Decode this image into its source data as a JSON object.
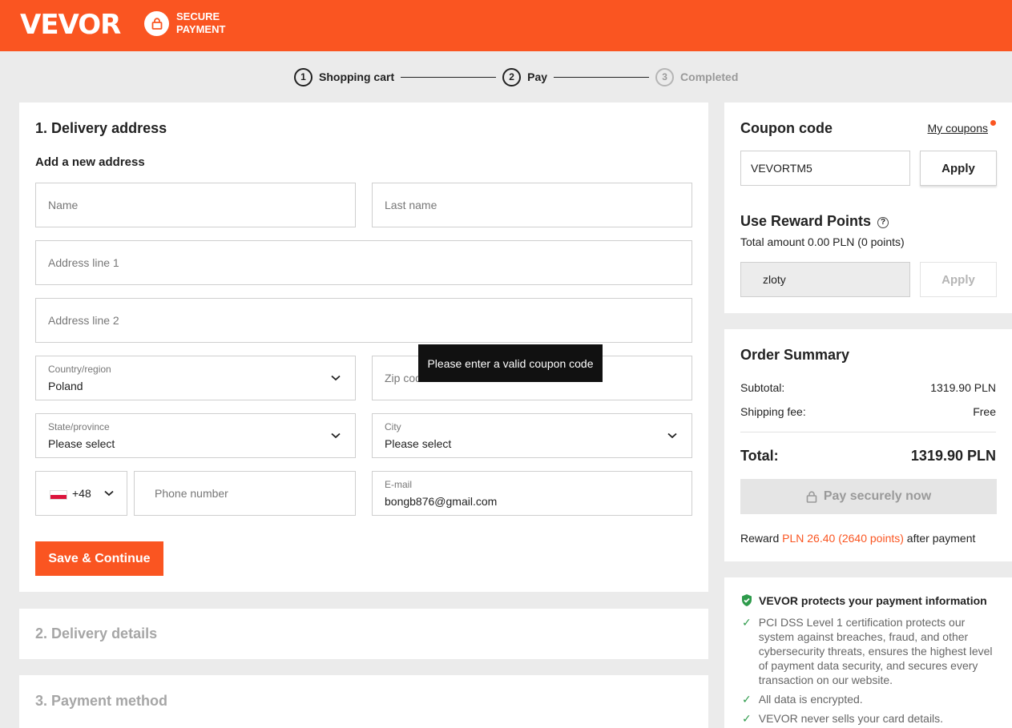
{
  "header": {
    "logo_text": "VEVOR",
    "secure_line1": "SECURE",
    "secure_line2": "PAYMENT",
    "accent_color": "#fa5521"
  },
  "steps": [
    {
      "num": "1",
      "label": "Shopping cart",
      "state": "done"
    },
    {
      "num": "2",
      "label": "Pay",
      "state": "current"
    },
    {
      "num": "3",
      "label": "Completed",
      "state": "upcoming"
    }
  ],
  "delivery": {
    "title": "1. Delivery address",
    "subtitle": "Add a new address",
    "name_placeholder": "Name",
    "last_name_placeholder": "Last name",
    "address1_placeholder": "Address line 1",
    "address2_placeholder": "Address line 2",
    "country_label": "Country/region",
    "country_value": "Poland",
    "zip_placeholder": "Zip code",
    "state_label": "State/province",
    "state_value": "Please select",
    "city_label": "City",
    "city_value": "Please select",
    "phone_code": "+48",
    "phone_placeholder": "Phone number",
    "email_label": "E-mail",
    "email_value": "bongb876@gmail.com",
    "save_label": "Save & Continue"
  },
  "tooltip": "Please enter a valid coupon code",
  "sections": {
    "delivery_details": "2. Delivery details",
    "payment_method": "3. Payment method"
  },
  "coupon": {
    "title": "Coupon code",
    "my_coupons": "My coupons",
    "input_value": "VEVORTM5",
    "apply_label": "Apply"
  },
  "reward_points": {
    "title": "Use Reward Points",
    "help_icon": "question-circle-icon",
    "total_text": "Total amount 0.00 PLN (0 points)",
    "currency_value": "zloty",
    "apply_label": "Apply"
  },
  "summary": {
    "title": "Order Summary",
    "subtotal_label": "Subtotal:",
    "subtotal_value": "1319.90 PLN",
    "shipping_label": "Shipping fee:",
    "shipping_value": "Free",
    "total_label": "Total:",
    "total_value": "1319.90 PLN",
    "pay_label": "Pay securely now",
    "reward_prefix": "Reward",
    "reward_highlight": "PLN 26.40 (2640 points)",
    "reward_suffix": "after payment"
  },
  "protect": {
    "title": "VEVOR protects your payment information",
    "items": [
      "PCI DSS Level 1 certification protects our system against breaches, fraud, and other cybersecurity threats, ensures the highest level of payment data security, and secures every transaction on our website.",
      "All data is encrypted.",
      "VEVOR never sells your card details."
    ]
  }
}
